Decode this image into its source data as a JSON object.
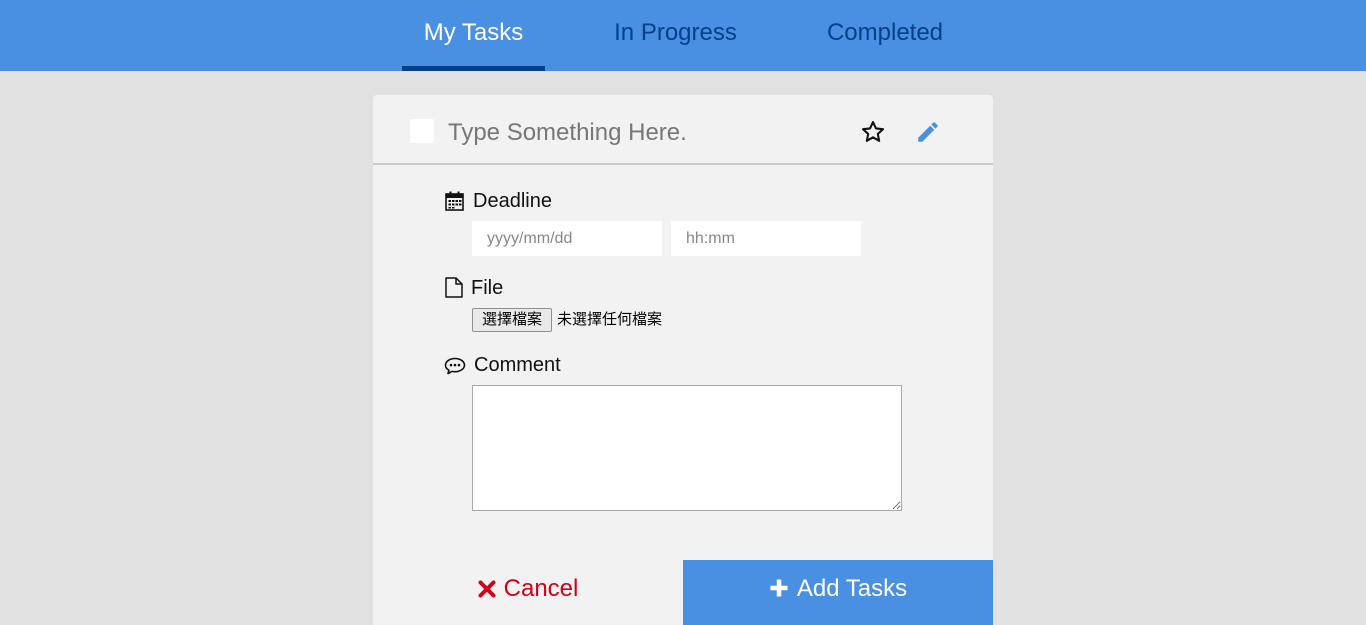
{
  "nav": {
    "tabs": [
      {
        "label": "My Tasks",
        "active": true
      },
      {
        "label": "In Progress",
        "active": false
      },
      {
        "label": "Completed",
        "active": false
      }
    ]
  },
  "task": {
    "title_placeholder": "Type Something Here.",
    "title_value": "",
    "checkbox_checked": false,
    "star_icon": "star-outline-icon",
    "edit_icon": "pencil-icon"
  },
  "deadline": {
    "label": "Deadline",
    "icon": "calendar-icon",
    "date_placeholder": "yyyy/mm/dd",
    "time_placeholder": "hh:mm"
  },
  "file": {
    "label": "File",
    "icon": "file-icon",
    "button_label": "選擇檔案",
    "status": "未選擇任何檔案"
  },
  "comment": {
    "label": "Comment",
    "icon": "comment-icon",
    "value": ""
  },
  "actions": {
    "cancel_label": "Cancel",
    "add_label": "Add Tasks"
  },
  "colors": {
    "primary": "#4a90e2",
    "nav_dark": "#00408b",
    "cancel": "#d0021b",
    "background": "#e1e1e1",
    "card": "#f2f2f2"
  }
}
